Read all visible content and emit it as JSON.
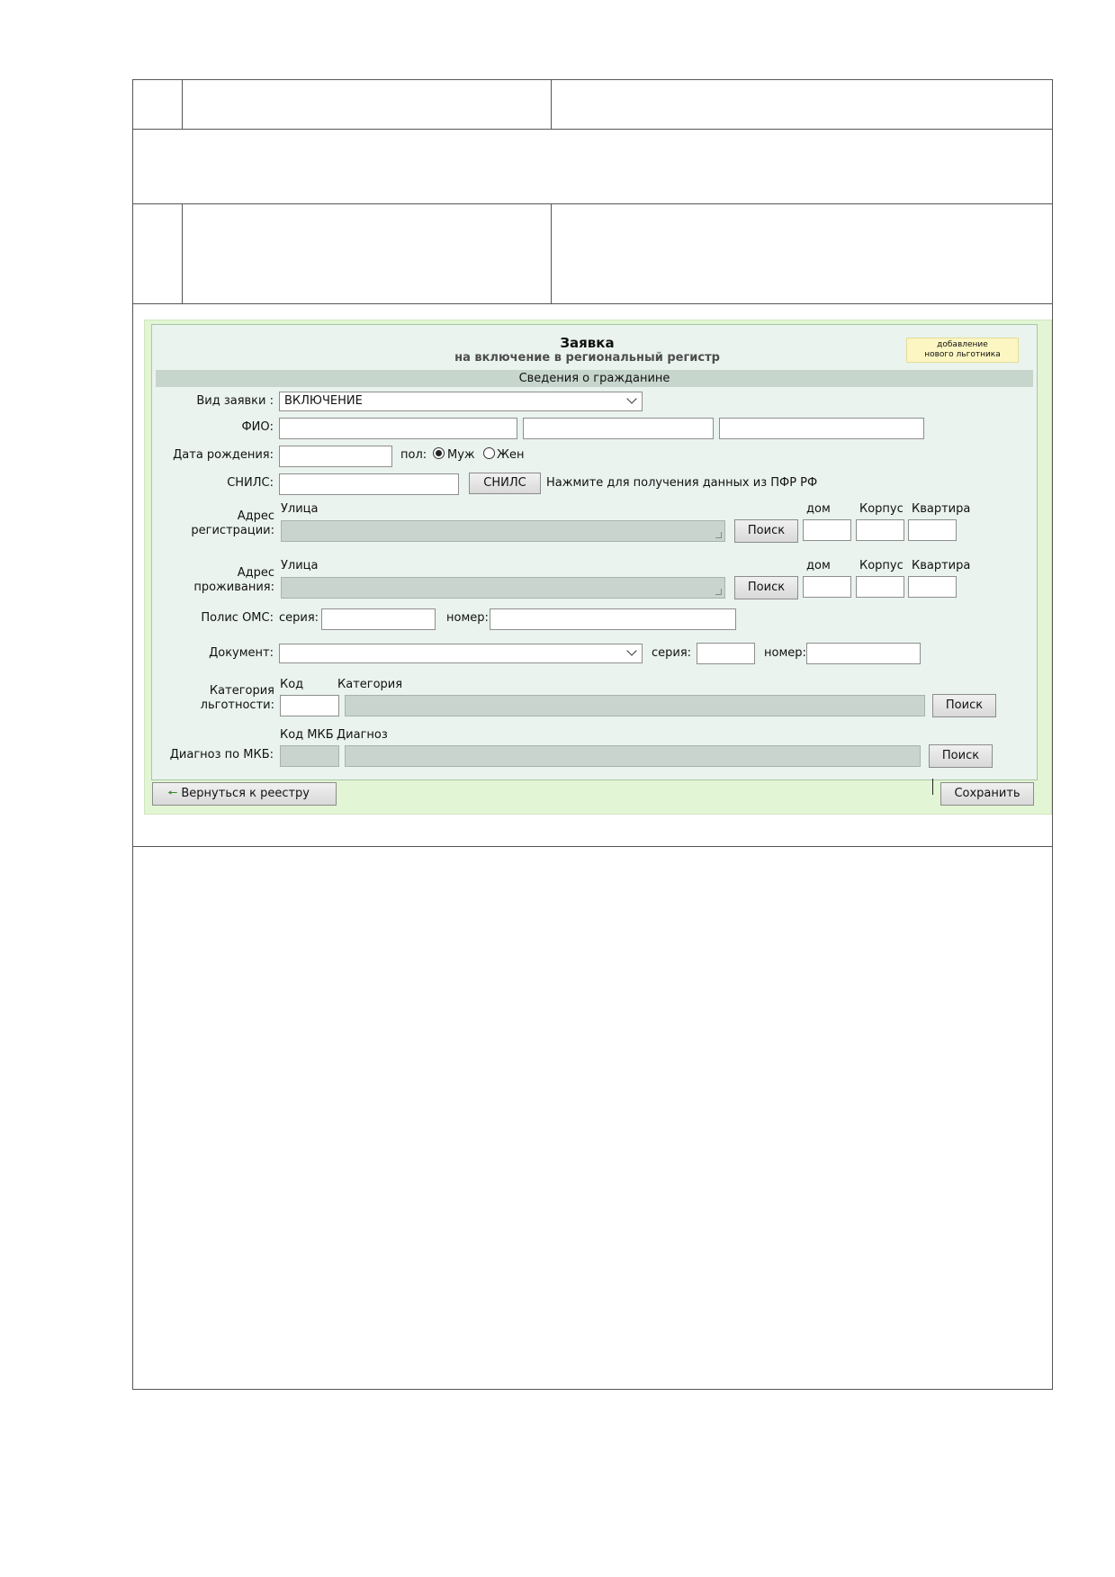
{
  "form": {
    "title": "Заявка",
    "subtitle": "на включение в региональный регистр",
    "badge_line1": "добавление",
    "badge_line2": "нового льготника",
    "section_header": "Сведения о гражданине",
    "request_type": {
      "label": "Вид заявки :",
      "value": "ВКЛЮЧЕНИЕ"
    },
    "fio": {
      "label": "ФИО:"
    },
    "birth_date": {
      "label": "Дата рождения:"
    },
    "gender": {
      "label": "пол:",
      "male": "Муж",
      "female": "Жен",
      "selected": "Муж"
    },
    "snils": {
      "label": "СНИЛС:",
      "button": "СНИЛС",
      "hint": "Нажмите для получения данных из ПФР РФ"
    },
    "reg_address": {
      "label_line1": "Адрес",
      "label_line2": "регистрации:",
      "street": "Улица",
      "house": "дом",
      "building": "Корпус",
      "apartment": "Квартира",
      "search": "Поиск"
    },
    "live_address": {
      "label_line1": "Адрес",
      "label_line2": "проживания:",
      "street": "Улица",
      "house": "дом",
      "building": "Корпус",
      "apartment": "Квартира",
      "search": "Поиск"
    },
    "oms": {
      "label": "Полис ОМС:",
      "series": "серия:",
      "number": "номер:"
    },
    "document": {
      "label": "Документ:",
      "value": "",
      "series": "серия:",
      "number": "номер:"
    },
    "benefit": {
      "label_line1": "Категория",
      "label_line2": "льготности:",
      "code": "Код",
      "category": "Категория",
      "search": "Поиск"
    },
    "diagnosis": {
      "label": "Диагноз по МКБ:",
      "code": "Код МКБ",
      "name": "Диагноз",
      "search": "Поиск"
    },
    "back_button": "Вернуться к реестру",
    "save_button": "Сохранить"
  }
}
